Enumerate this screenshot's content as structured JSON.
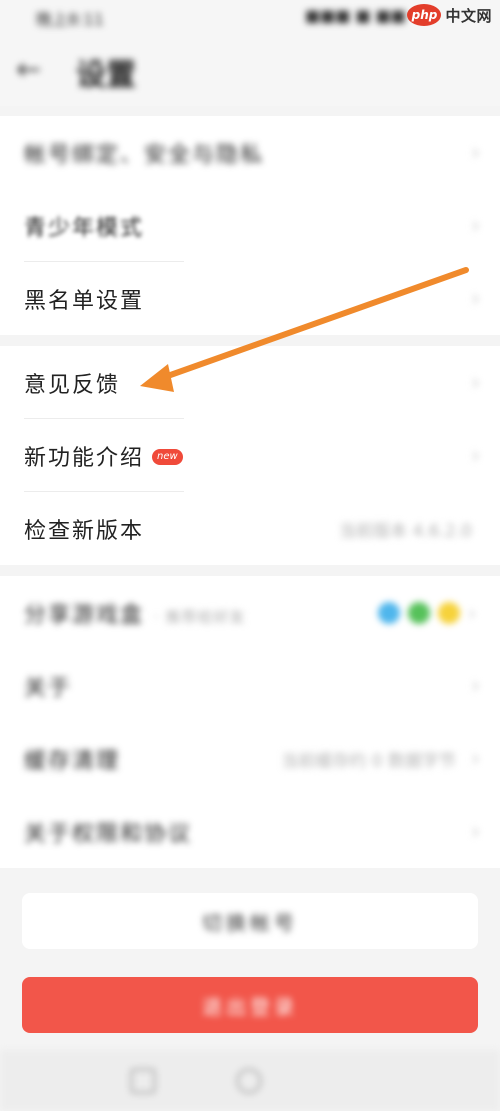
{
  "status_bar": {
    "left": "晚上8:11",
    "right": "■■■ ■ ■■"
  },
  "watermark": {
    "logo": "php",
    "text": "中文网"
  },
  "header": {
    "back_glyph": "←",
    "title": "设置"
  },
  "section1": {
    "items": [
      {
        "label": "帐号绑定、安全与隐私",
        "chevron": "›"
      },
      {
        "label": "青少年模式",
        "chevron": "›"
      },
      {
        "label": "黑名单设置",
        "chevron": "›"
      }
    ]
  },
  "section2": {
    "items": [
      {
        "label": "意见反馈",
        "chevron": "›"
      },
      {
        "label": "新功能介绍",
        "badge": "new",
        "chevron": "›"
      },
      {
        "label": "检查新版本",
        "value": "当前版本 4.6.2.0"
      }
    ]
  },
  "section3": {
    "items": [
      {
        "label": "分享游戏盒",
        "sub": "· 推荐给好友",
        "chevron": "›"
      },
      {
        "label": "关于",
        "chevron": "›"
      },
      {
        "label": "缓存清理",
        "value": "当前缓存约 0 数据字节",
        "chevron": "›"
      },
      {
        "label": "关于权限和协议",
        "chevron": "›"
      }
    ]
  },
  "buttons": {
    "switch_account": "切换帐号",
    "logout": "退出登录"
  },
  "colors": {
    "logout_red": "#f2564a",
    "badge_red": "#f04a3a",
    "arrow_orange": "#f08a2c"
  }
}
